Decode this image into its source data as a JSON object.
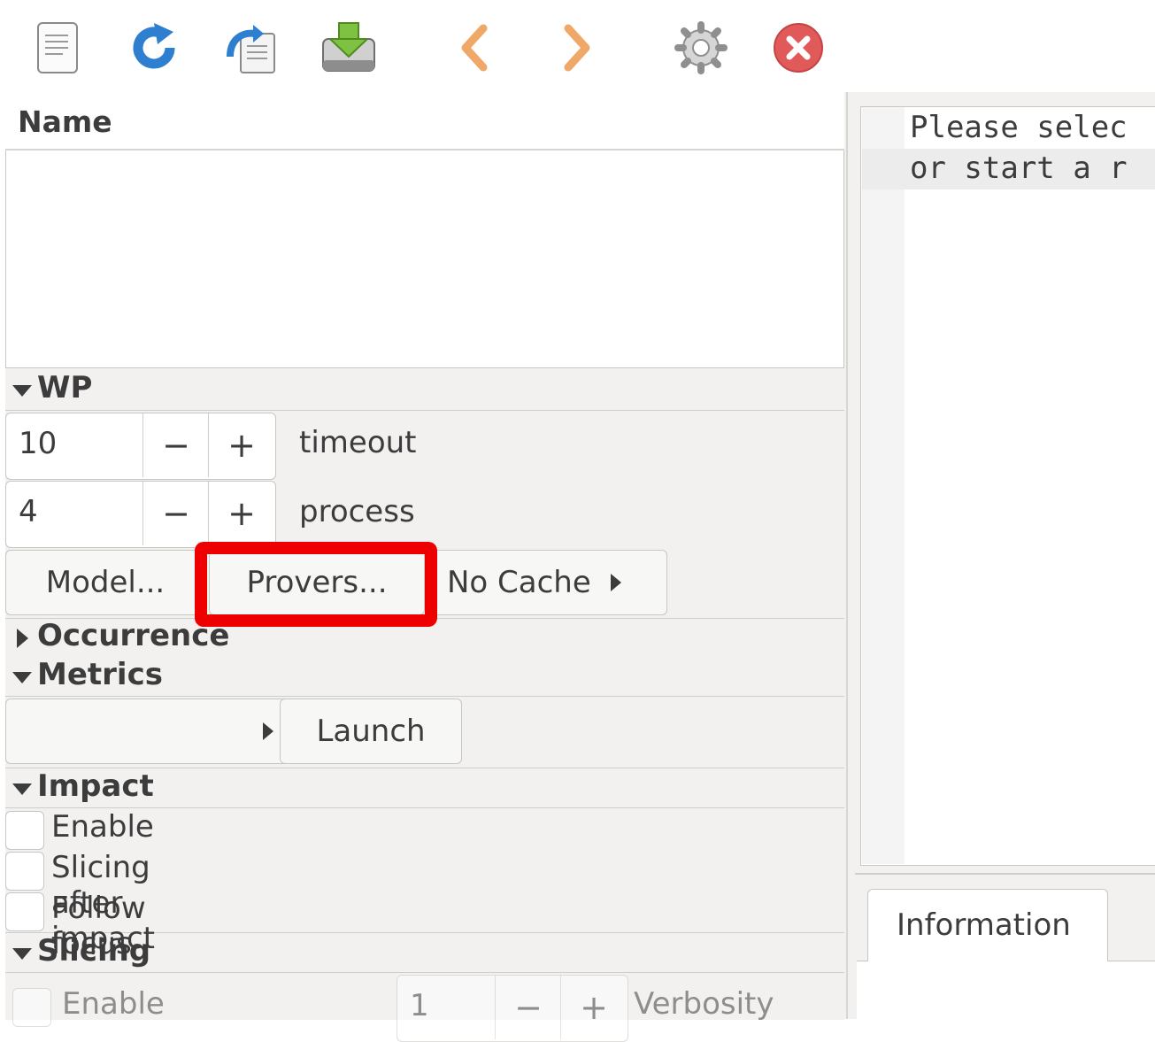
{
  "toolbar": {
    "icons": [
      "document-icon",
      "refresh-icon",
      "reparse-icon",
      "save-icon",
      "back-icon",
      "forward-icon",
      "settings-icon",
      "exit-icon"
    ]
  },
  "tree": {
    "column_name": "Name"
  },
  "wp": {
    "title": "WP",
    "timeout_value": "10",
    "timeout_label": "timeout",
    "process_value": "4",
    "process_label": "process",
    "model_button": "Model...",
    "provers_button": "Provers...",
    "cache_button": "No Cache",
    "minus": "−",
    "plus": "+"
  },
  "occurrence": {
    "title": "Occurrence"
  },
  "metrics": {
    "title": "Metrics",
    "launch_button": "Launch"
  },
  "impact": {
    "title": "Impact",
    "enable": "Enable",
    "slicing_after_impact": "Slicing after impact",
    "follow_focus": "Follow focus"
  },
  "slicing": {
    "title": "Slicing",
    "enable": "Enable",
    "verbosity_value": "1",
    "verbosity_label": "Verbosity"
  },
  "source": {
    "line1": "Please selec",
    "line2": "or start a r"
  },
  "messages": {
    "info_tab": "Information"
  },
  "colors": {
    "highlight": "#ee0000",
    "panel_bg": "#f2f1f0"
  }
}
